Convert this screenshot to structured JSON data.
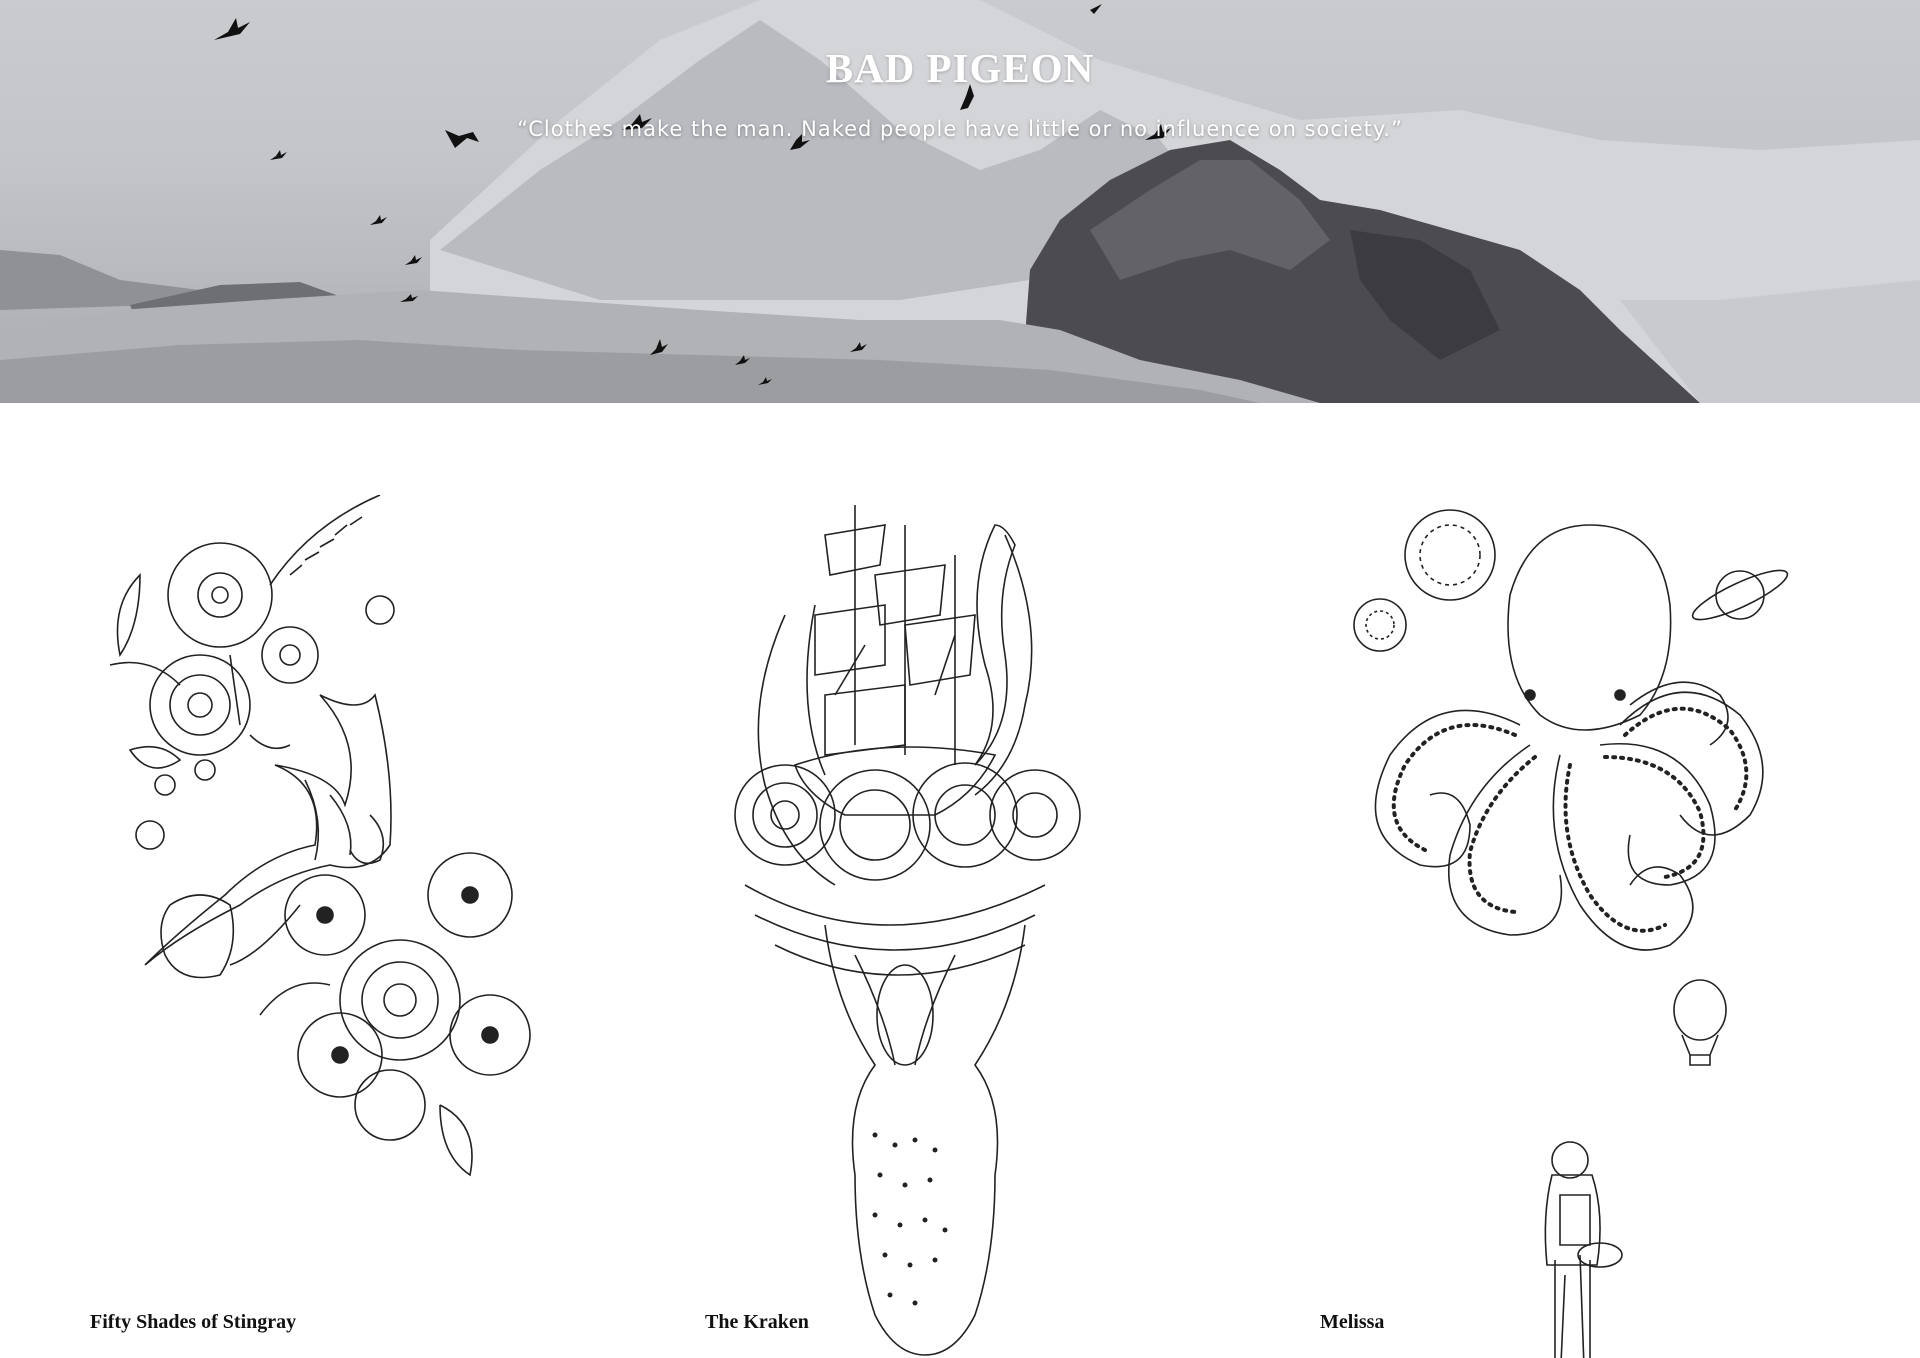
{
  "site": {
    "title": "BAD PIGEON",
    "quote": "“Clothes make the man. Naked people have little or no influence on society.”"
  },
  "colors": {
    "hero_sky": "#c6c8cc",
    "mountain_dark": "#4a4a4d",
    "mountain_mid": "#8d8f93",
    "snow": "#e9eaec",
    "bird": "#111111",
    "text_dark": "#111111",
    "background": "#ffffff"
  },
  "gallery": {
    "items": [
      {
        "title": "Fifty Shades of Stingray",
        "illustration": "stingray-with-flowers-illustration"
      },
      {
        "title": "The Kraken",
        "illustration": "kraken-with-ship-illustration"
      },
      {
        "title": "Melissa",
        "illustration": "octopus-with-planets-and-cyclist-illustration"
      }
    ]
  }
}
